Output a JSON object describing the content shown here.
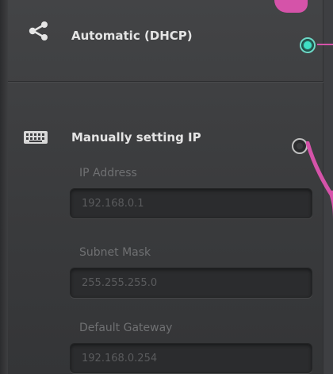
{
  "colors": {
    "panel_background": "#3a3b3d",
    "accent_selected": "#3fe0c5",
    "callout_marker": "#d553a9",
    "label_text": "#e4e4e4",
    "disabled_text": "#6f7072"
  },
  "dhcp_option": {
    "icon": "share-network-icon",
    "label": "Automatic (DHCP)",
    "selected": true
  },
  "manual_option": {
    "icon": "keyboard-icon",
    "label": "Manually setting IP",
    "selected": false,
    "fields": [
      {
        "label": "IP Address",
        "value": "192.168.0.1"
      },
      {
        "label": "Subnet Mask",
        "value": "255.255.255.0"
      },
      {
        "label": "Default Gateway",
        "value": "192.168.0.254"
      }
    ]
  }
}
